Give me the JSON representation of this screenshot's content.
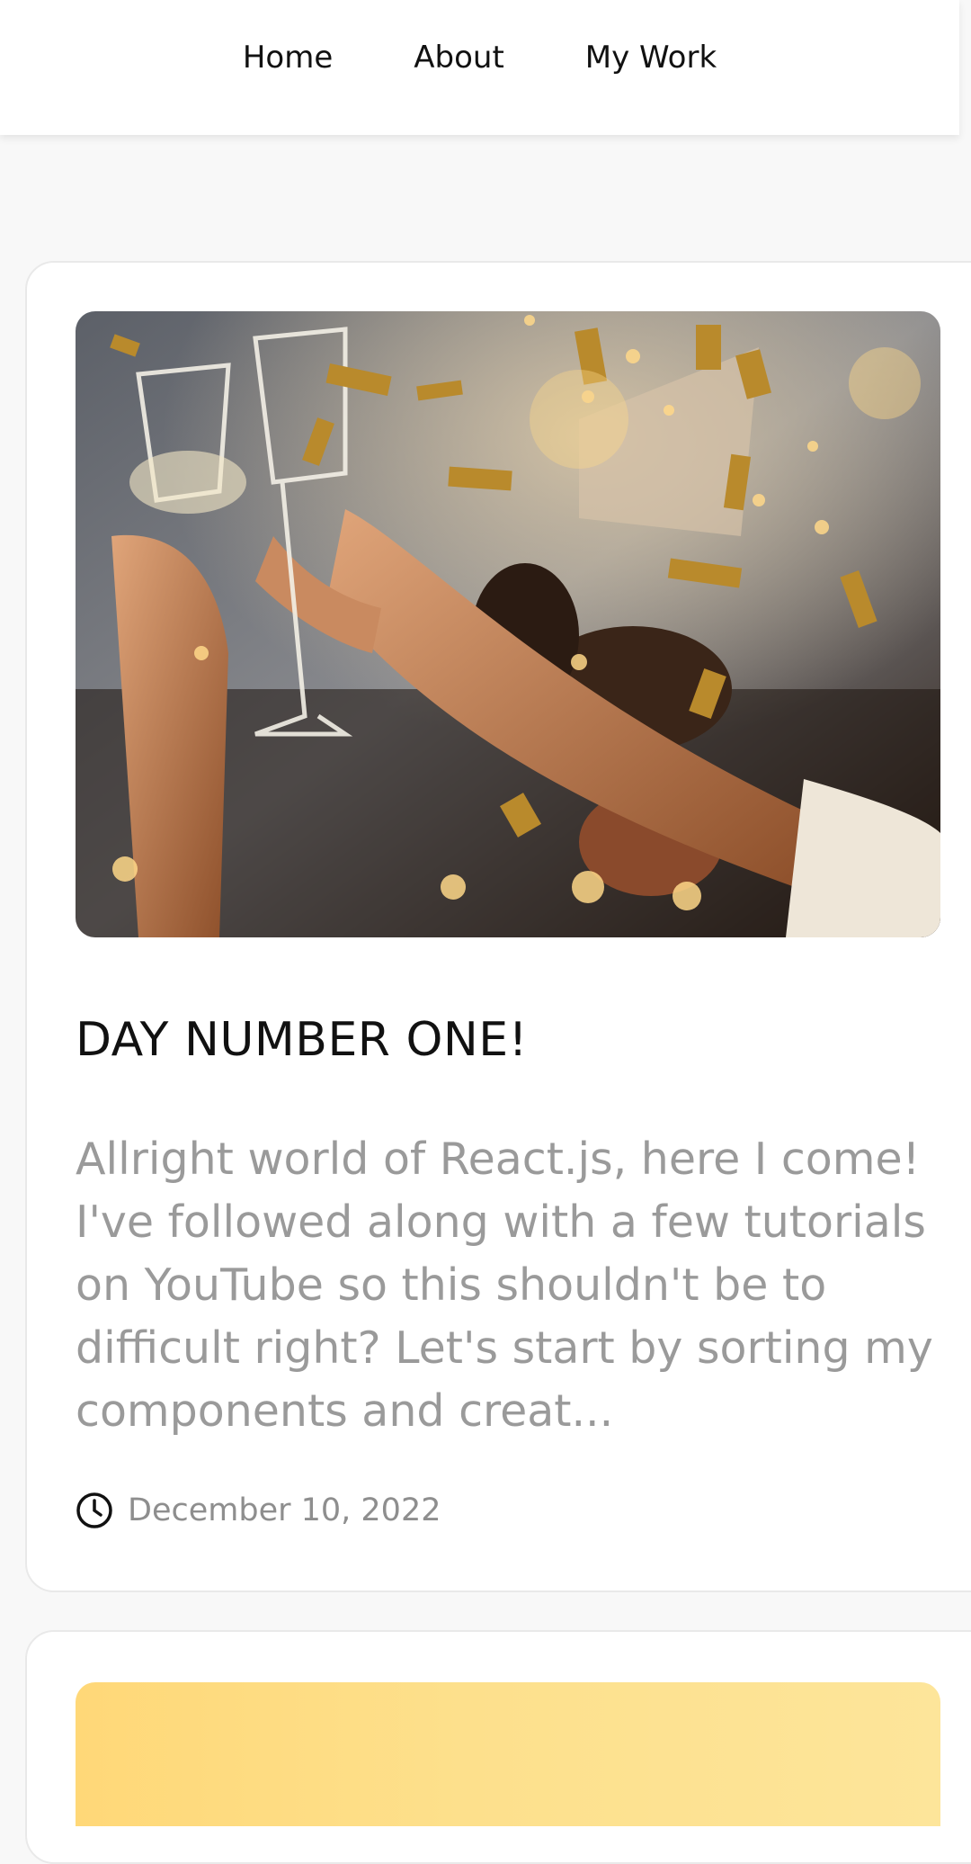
{
  "nav": {
    "items": [
      {
        "label": "Home"
      },
      {
        "label": "About"
      },
      {
        "label": "My Work"
      }
    ]
  },
  "posts": [
    {
      "image_icon": "party-celebration-photo",
      "title": "DAY NUMBER ONE!",
      "excerpt": "Allright world of React.js, here I come! I've followed along with a few tutorials on YouTube so this shouldn't be to difficult right? Let's start by sorting my components and creat...",
      "date_icon": "clock-icon",
      "date": "December 10, 2022"
    },
    {
      "image_icon": "yellow-gradient-photo"
    }
  ],
  "colors": {
    "background": "#f8f8f8",
    "card": "#ffffff",
    "title": "#111111",
    "excerpt": "#9a9a9a",
    "date": "#8e8e8e"
  }
}
